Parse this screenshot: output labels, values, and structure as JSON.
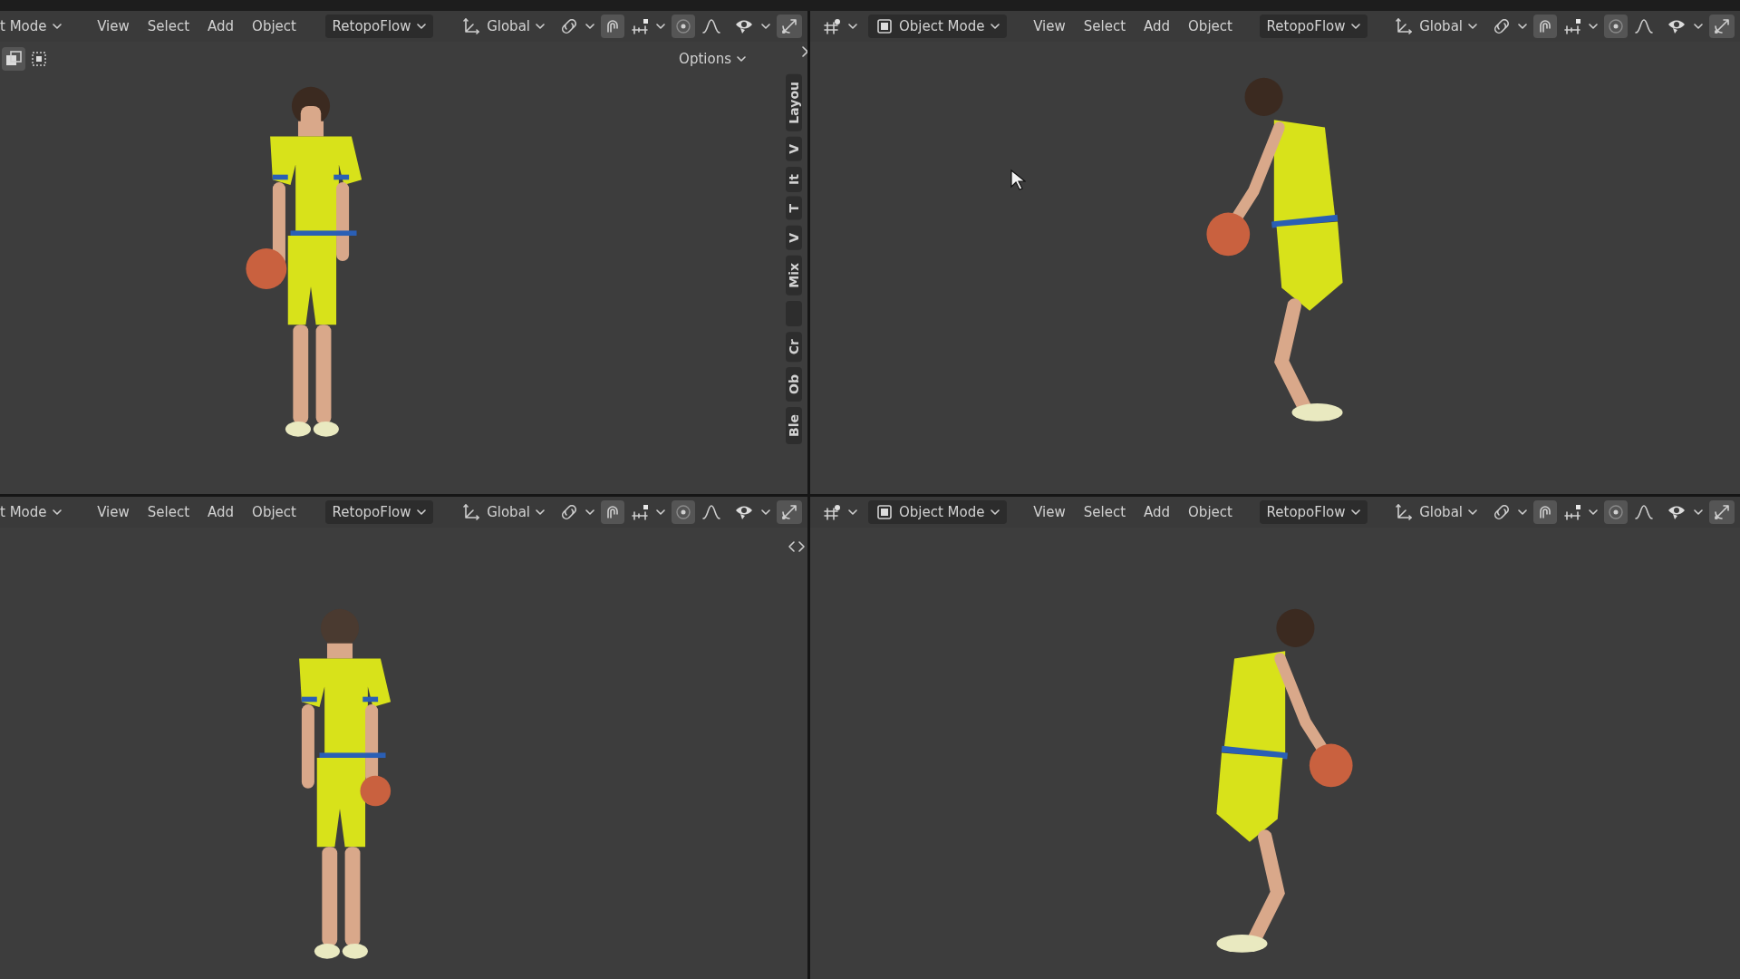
{
  "viewports": [
    {
      "kind": "cut",
      "mode_label": "t Mode",
      "menus": [
        "View",
        "Select",
        "Add",
        "Object"
      ],
      "addon_menu": "RetopoFlow",
      "orientation": "Global",
      "snapping_on": true,
      "proportional_on": true,
      "options_button": "Options",
      "sidebar_tabs": [
        {
          "kind": "text",
          "label": "Layou"
        },
        {
          "kind": "text",
          "label": "V"
        },
        {
          "kind": "text",
          "label": "It"
        },
        {
          "kind": "text",
          "label": "T"
        },
        {
          "kind": "text",
          "label": "V"
        },
        {
          "kind": "text",
          "label": "Mix"
        },
        {
          "kind": "blank"
        },
        {
          "kind": "text",
          "label": "Cr"
        },
        {
          "kind": "text",
          "label": "Ob"
        },
        {
          "kind": "text",
          "label": "Ble"
        }
      ],
      "figure": {
        "kind": "front"
      }
    },
    {
      "kind": "full",
      "mode_label": "Object Mode",
      "menus": [
        "View",
        "Select",
        "Add",
        "Object"
      ],
      "addon_menu": "RetopoFlow",
      "orientation": "Global",
      "snapping_on": true,
      "proportional_on": true,
      "cursor": true,
      "figure": {
        "kind": "side-left"
      }
    },
    {
      "kind": "cut",
      "mode_label": "t Mode",
      "menus": [
        "View",
        "Select",
        "Add",
        "Object"
      ],
      "addon_menu": "RetopoFlow",
      "orientation": "Global",
      "snapping_on": true,
      "proportional_on": true,
      "figure": {
        "kind": "back"
      }
    },
    {
      "kind": "full",
      "mode_label": "Object Mode",
      "menus": [
        "View",
        "Select",
        "Add",
        "Object"
      ],
      "addon_menu": "RetopoFlow",
      "orientation": "Global",
      "snapping_on": true,
      "proportional_on": true,
      "figure": {
        "kind": "side-right"
      }
    }
  ]
}
